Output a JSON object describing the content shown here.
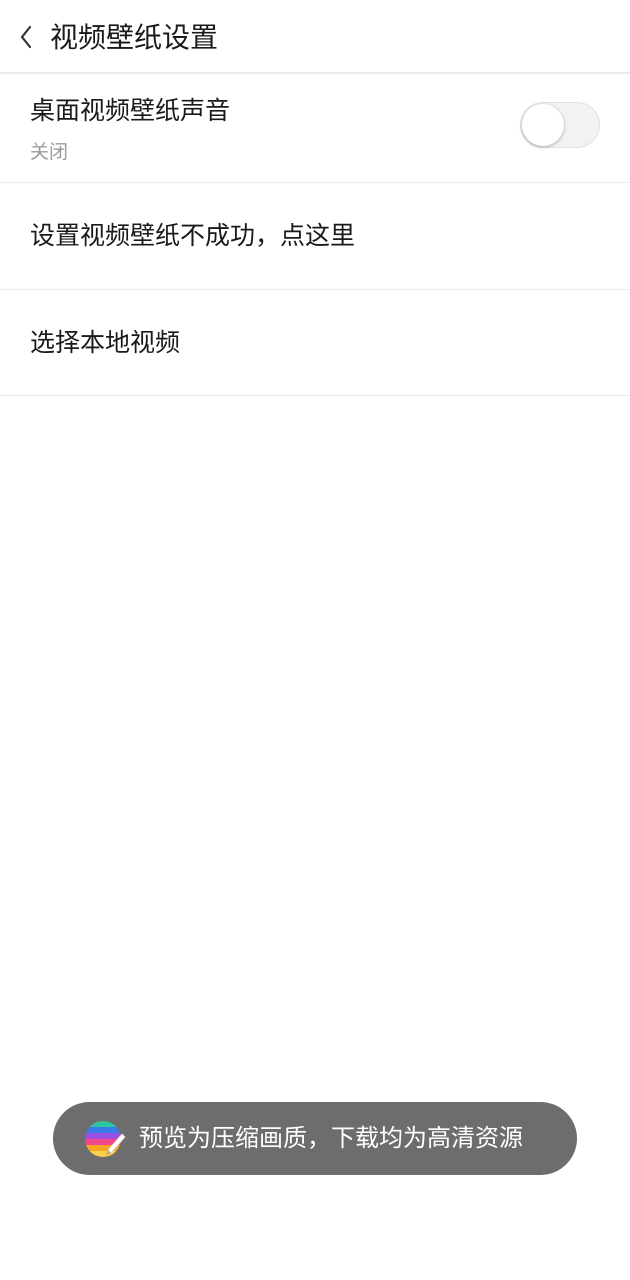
{
  "header": {
    "title": "视频壁纸设置",
    "back_icon": "chevron-left-icon"
  },
  "settings": {
    "sound": {
      "label": "桌面视频壁纸声音",
      "status": "关闭",
      "toggle_on": false
    },
    "fail_help": {
      "label": "设置视频壁纸不成功，点这里"
    },
    "local_video": {
      "label": "选择本地视频"
    }
  },
  "toast": {
    "icon": "app-logo-icon",
    "text": "预览为压缩画质，下载均为高清资源"
  },
  "colors": {
    "toast_bg": "#6d6d6d",
    "divider": "#ececec",
    "subtext": "#9a9a9a"
  }
}
